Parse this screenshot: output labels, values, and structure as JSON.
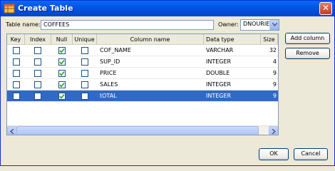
{
  "window": {
    "title": "Create Table",
    "close_label": "✕"
  },
  "form": {
    "table_name_label": "Table name:",
    "table_name_value": "COFFEES",
    "owner_label": "Owner:",
    "owner_value": "DNOURIE"
  },
  "table": {
    "headers": [
      "Key",
      "Index",
      "Null",
      "Unique",
      "Column name",
      "Data type",
      "Size"
    ],
    "rows": [
      {
        "key": false,
        "index": false,
        "null": true,
        "unique": false,
        "column_name": "COF_NAME",
        "data_type": "VARCHAR",
        "size": "32",
        "selected": false
      },
      {
        "key": false,
        "index": false,
        "null": true,
        "unique": false,
        "column_name": "SUP_ID",
        "data_type": "INTEGER",
        "size": "4",
        "selected": false
      },
      {
        "key": false,
        "index": false,
        "null": true,
        "unique": false,
        "column_name": "PRICE",
        "data_type": "DOUBLE",
        "size": "9",
        "selected": false
      },
      {
        "key": false,
        "index": false,
        "null": true,
        "unique": false,
        "column_name": "SALES",
        "data_type": "INTEGER",
        "size": "9",
        "selected": false
      },
      {
        "key": false,
        "index": false,
        "null": true,
        "unique": false,
        "column_name": "tOTAL",
        "data_type": "INTEGER",
        "size": "9",
        "selected": true
      }
    ]
  },
  "buttons": {
    "add_column": "Add column",
    "remove": "Remove",
    "ok": "OK",
    "cancel": "Cancel"
  },
  "colors": {
    "titlebar": "#0054e3",
    "selection": "#316ac5",
    "dialog_bg": "#ece9d8"
  },
  "icons": {
    "window": "table-app-icon",
    "close": "close-icon",
    "combo": "chevron-down-icon",
    "check": "check-icon"
  }
}
